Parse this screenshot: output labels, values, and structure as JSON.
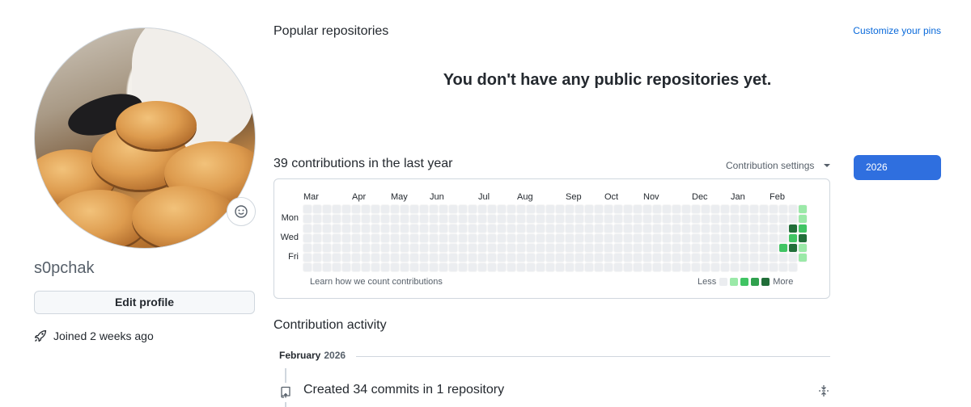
{
  "profile": {
    "username": "s0pchak",
    "edit_label": "Edit profile",
    "joined_text": "Joined 2 weeks ago",
    "emoji_icon": "smiley-icon",
    "rocket_icon": "rocket-icon"
  },
  "popular": {
    "title": "Popular repositories",
    "customize_label": "Customize your pins",
    "empty_message": "You don't have any public repositories yet."
  },
  "contributions": {
    "title": "39 contributions in the last year",
    "settings_label": "Contribution settings",
    "year_button": "2026",
    "months": [
      "Mar",
      "Apr",
      "May",
      "Jun",
      "Jul",
      "Aug",
      "Sep",
      "Oct",
      "Nov",
      "Dec",
      "Jan",
      "Feb"
    ],
    "weekdays": [
      "Mon",
      "Wed",
      "Fri"
    ],
    "learn_label": "Learn how we count contributions",
    "legend_less": "Less",
    "legend_more": "More",
    "colors": [
      "#ebedf0",
      "#9be9a8",
      "#40c463",
      "#30a14e",
      "#216e39"
    ],
    "active_cells": [
      {
        "week": 51,
        "day": 0,
        "level": 1
      },
      {
        "week": 51,
        "day": 1,
        "level": 1
      },
      {
        "week": 51,
        "day": 2,
        "level": 2
      },
      {
        "week": 51,
        "day": 3,
        "level": 4
      },
      {
        "week": 51,
        "day": 4,
        "level": 1
      },
      {
        "week": 51,
        "day": 5,
        "level": 1
      },
      {
        "week": 50,
        "day": 2,
        "level": 4
      },
      {
        "week": 50,
        "day": 3,
        "level": 2
      },
      {
        "week": 50,
        "day": 4,
        "level": 4
      },
      {
        "week": 49,
        "day": 4,
        "level": 2
      }
    ]
  },
  "activity": {
    "title": "Contribution activity",
    "month": "February",
    "year": "2026",
    "item_text": "Created 34 commits in 1 repository"
  }
}
